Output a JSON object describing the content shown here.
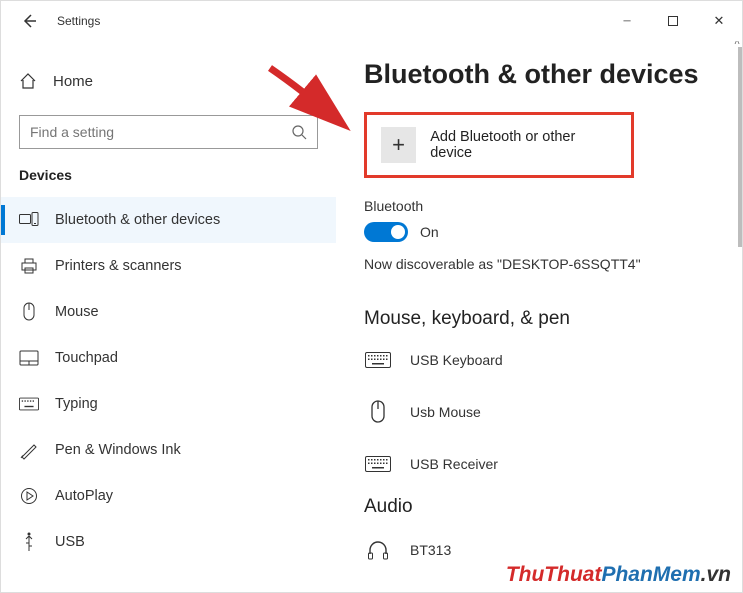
{
  "titlebar": {
    "title": "Settings"
  },
  "sidebar": {
    "home_label": "Home",
    "search_placeholder": "Find a setting",
    "section_title": "Devices",
    "items": [
      {
        "label": "Bluetooth & other devices"
      },
      {
        "label": "Printers & scanners"
      },
      {
        "label": "Mouse"
      },
      {
        "label": "Touchpad"
      },
      {
        "label": "Typing"
      },
      {
        "label": "Pen & Windows Ink"
      },
      {
        "label": "AutoPlay"
      },
      {
        "label": "USB"
      }
    ]
  },
  "main": {
    "heading": "Bluetooth & other devices",
    "add_device_label": "Add Bluetooth or other device",
    "bluetooth_label": "Bluetooth",
    "toggle_state_label": "On",
    "discoverable_text": "Now discoverable as \"DESKTOP-6SSQTT4\"",
    "section1_title": "Mouse, keyboard, & pen",
    "devices1": [
      {
        "label": "USB Keyboard"
      },
      {
        "label": "Usb Mouse"
      },
      {
        "label": "USB Receiver"
      }
    ],
    "section2_title": "Audio",
    "devices2": [
      {
        "label": "BT313"
      }
    ]
  },
  "watermark": {
    "p1": "ThuThuat",
    "p2": "PhanMem",
    "p3": ".vn"
  }
}
